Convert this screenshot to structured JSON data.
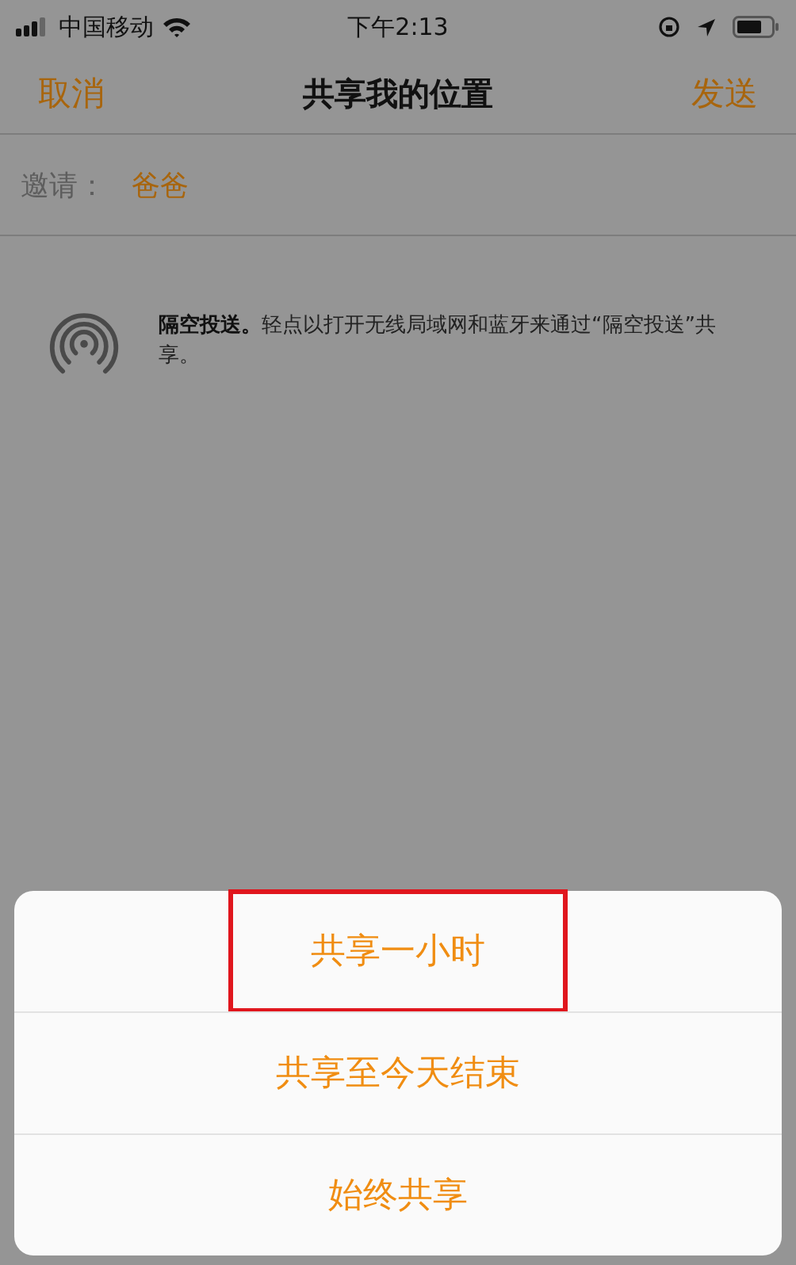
{
  "status_bar": {
    "carrier": "中国移动",
    "time": "下午2:13"
  },
  "nav": {
    "cancel": "取消",
    "title": "共享我的位置",
    "send": "发送"
  },
  "invite": {
    "label": "邀请：",
    "recipient": "爸爸"
  },
  "airdrop": {
    "bold": "隔空投送。",
    "text": "轻点以打开无线局域网和蓝牙来通过“隔空投送”共享。"
  },
  "action_sheet": {
    "options": [
      {
        "label": "共享一小时",
        "highlighted": true
      },
      {
        "label": "共享至今天结束",
        "highlighted": false
      },
      {
        "label": "始终共享",
        "highlighted": false
      }
    ]
  }
}
